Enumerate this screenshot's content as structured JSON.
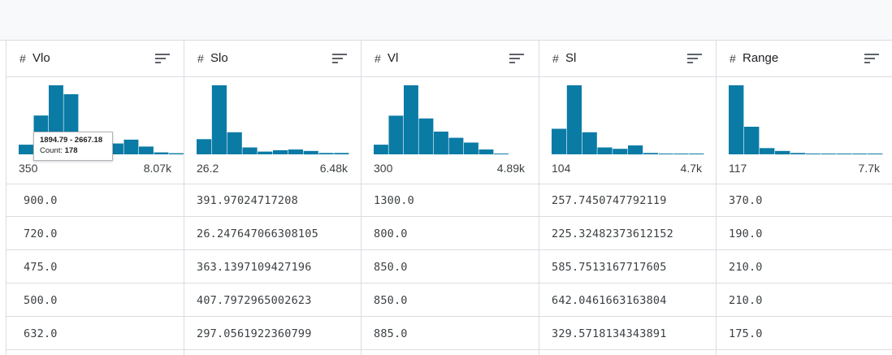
{
  "colors": {
    "bar": "#0a7ba5",
    "bar_highlight": "#0a7ba5",
    "border": "#dadce0",
    "header_bg": "#f8f9fb"
  },
  "icons": {
    "sort": "sort-lines-icon"
  },
  "columns": [
    {
      "type_symbol": "#",
      "name": "Vlo",
      "hist": {
        "min_label": "350",
        "max_label": "8.07k",
        "counts": [
          25,
          100,
          178,
          155,
          38,
          12,
          28,
          38,
          20,
          5,
          3
        ]
      },
      "values": [
        "900.0",
        "720.0",
        "475.0",
        "500.0",
        "632.0"
      ]
    },
    {
      "type_symbol": "#",
      "name": "Slo",
      "hist": {
        "min_label": "26.2",
        "max_label": "6.48k",
        "counts": [
          22,
          100,
          32,
          10,
          4,
          6,
          7,
          5,
          2,
          2
        ]
      },
      "values": [
        "391.97024717208",
        "26.247647066308105",
        "363.1397109427196",
        "407.7972965002623",
        "297.0561922360799"
      ]
    },
    {
      "type_symbol": "#",
      "name": "Vl",
      "hist": {
        "min_label": "300",
        "max_label": "4.89k",
        "counts": [
          14,
          56,
          100,
          52,
          33,
          24,
          17,
          7,
          1
        ]
      },
      "values": [
        "1300.0",
        "800.0",
        "850.0",
        "850.0",
        "885.0"
      ]
    },
    {
      "type_symbol": "#",
      "name": "Sl",
      "hist": {
        "min_label": "104",
        "max_label": "4.7k",
        "counts": [
          37,
          100,
          32,
          10,
          8,
          13,
          2,
          1,
          0,
          0
        ]
      },
      "values": [
        "257.7450747792119",
        "225.32482373612152",
        "585.7513167717605",
        "642.0461663163804",
        "329.5718134343891"
      ]
    },
    {
      "type_symbol": "#",
      "name": "Range",
      "hist": {
        "min_label": "117",
        "max_label": "7.7k",
        "counts": [
          100,
          40,
          9,
          5,
          2,
          1,
          0,
          0,
          0,
          0
        ]
      },
      "values": [
        "370.0",
        "190.0",
        "210.0",
        "210.0",
        "175.0"
      ]
    }
  ],
  "tooltip": {
    "range": "1894.79 - 2667.18",
    "count_label": "Count:",
    "count_value": "178"
  }
}
